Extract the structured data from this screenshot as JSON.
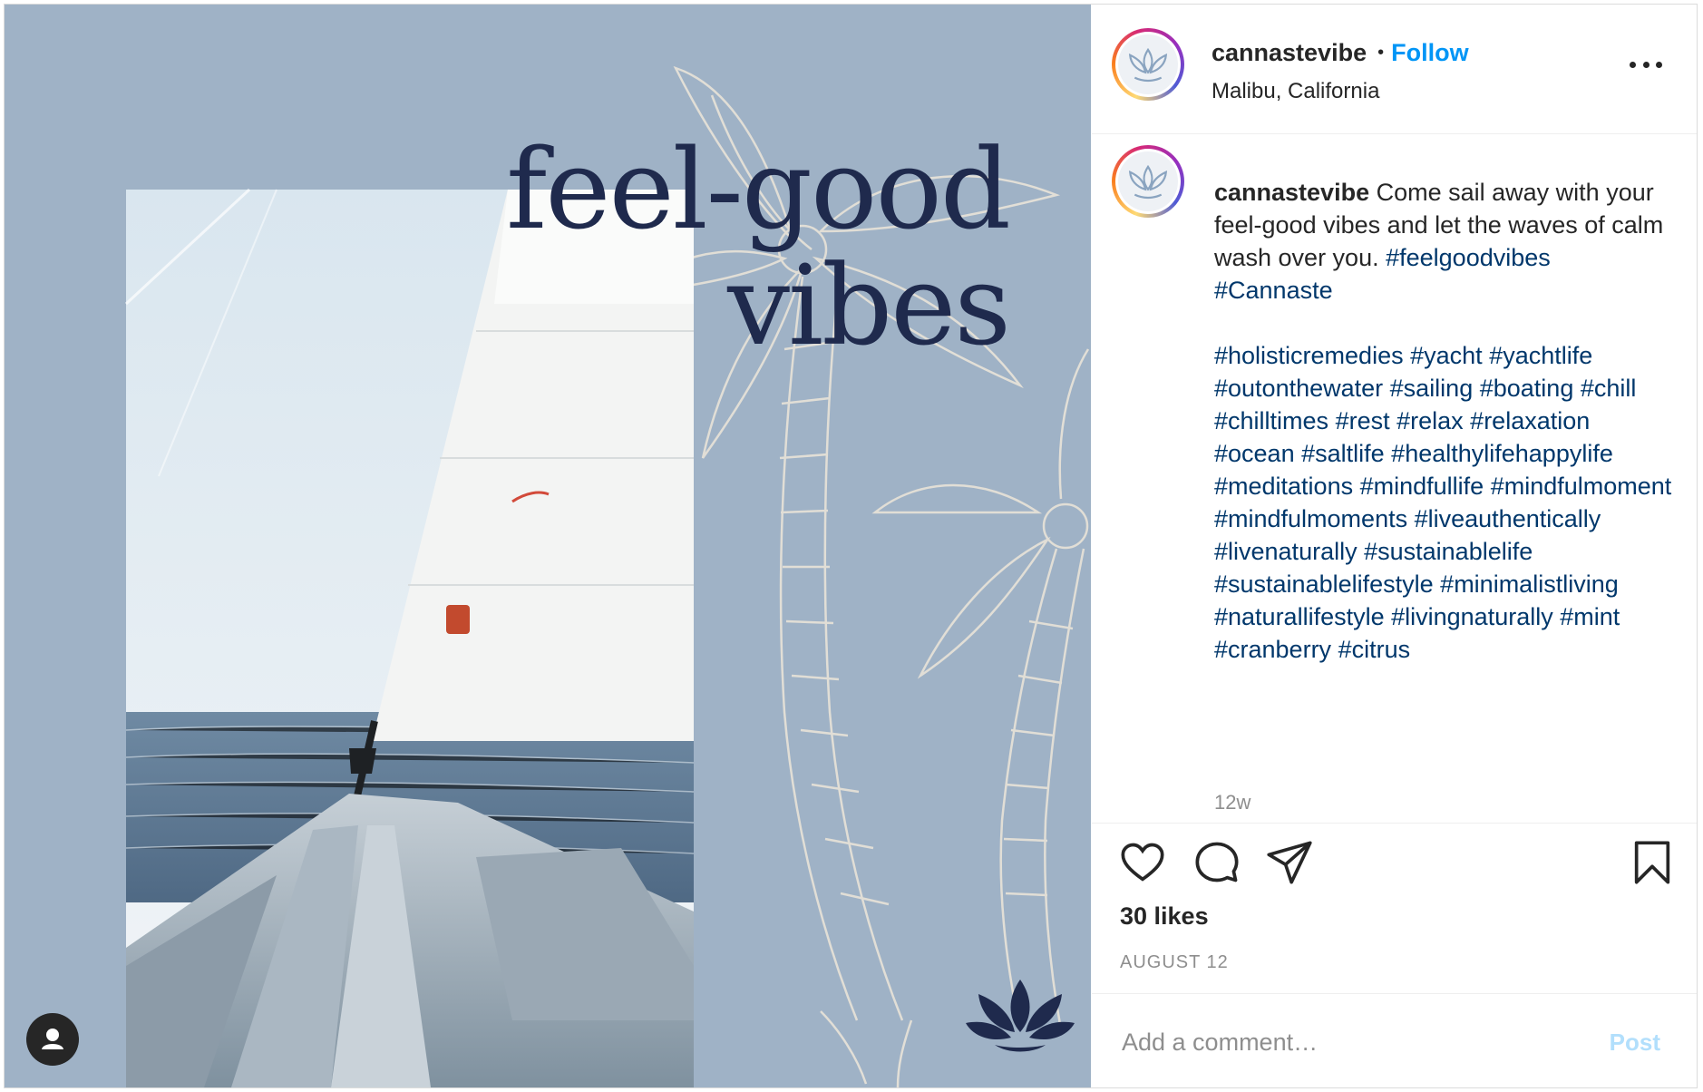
{
  "post": {
    "image_text": {
      "line1": "feel-good",
      "line2": "vibes"
    },
    "colors": {
      "media_bg": "#9fb2c6",
      "headline": "#1f2a4d",
      "follow": "#0095f6",
      "hashtag": "#00376b"
    }
  },
  "header": {
    "username": "cannastevibe",
    "separator": "•",
    "follow_label": "Follow",
    "location": "Malibu, California",
    "more_icon": "more-options-icon"
  },
  "caption": {
    "username": "cannastevibe",
    "text": "Come sail away with your feel-good vibes and let the waves of calm wash over you.",
    "first_tags": [
      "#feelgoodvibes",
      "#Cannaste"
    ],
    "tags": [
      "#holisticremedies",
      "#yacht",
      "#yachtlife",
      "#outonthewater",
      "#sailing",
      "#boating",
      "#chill",
      "#chilltimes",
      "#rest",
      "#relax",
      "#relaxation",
      "#ocean",
      "#saltlife",
      "#healthylifehappylife",
      "#meditations",
      "#mindfullife",
      "#mindfulmoment",
      "#mindfulmoments",
      "#liveauthentically",
      "#livenaturally",
      "#sustainablelife",
      "#sustainablelifestyle",
      "#minimalistliving",
      "#naturallifestyle",
      "#livingnaturally",
      "#mint",
      "#cranberry",
      "#citrus"
    ],
    "time_ago": "12w"
  },
  "actions": {
    "icons": [
      "heart-icon",
      "comment-icon",
      "share-icon",
      "bookmark-icon"
    ],
    "likes": "30 likes",
    "date": "AUGUST 12"
  },
  "comment": {
    "placeholder": "Add a comment…",
    "post_label": "Post"
  }
}
